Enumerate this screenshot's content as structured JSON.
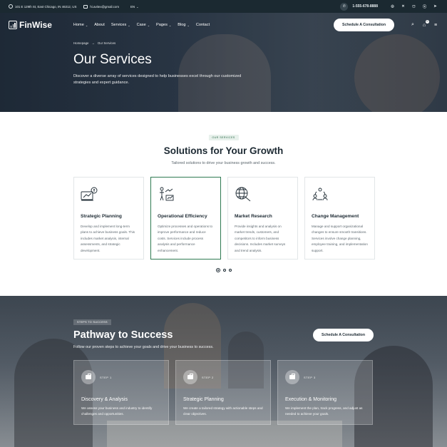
{
  "topbar": {
    "address": "101 E 129th St, East Chicago, IN 46312, US",
    "email": "hi.avitex@gmail.com",
    "language": "EN",
    "phone": "1-555-678-8888",
    "socials": [
      "whatsapp-icon",
      "x-icon",
      "instagram-icon",
      "skype-icon",
      "telegram-icon"
    ]
  },
  "nav": {
    "logo": "FinWise",
    "items": [
      {
        "label": "Home",
        "dropdown": true
      },
      {
        "label": "About",
        "dropdown": false
      },
      {
        "label": "Services",
        "dropdown": true
      },
      {
        "label": "Case",
        "dropdown": true
      },
      {
        "label": "Pages",
        "dropdown": true
      },
      {
        "label": "Blog",
        "dropdown": true
      },
      {
        "label": "Contact",
        "dropdown": false
      }
    ],
    "cta": "Schedule A Consultation"
  },
  "hero": {
    "breadcrumb": [
      "Homepage",
      "Our Services"
    ],
    "title": "Our Services",
    "subtitle": "Discover a diverse array of services designed to help businesses excel through our customized strategies and expert guidance."
  },
  "services": {
    "tag": "OUR SERVICES",
    "title": "Solutions for Your Growth",
    "subtitle": "Tailored solutions to drive your business growth and success.",
    "cards": [
      {
        "title": "Strategic Planning",
        "text": "Develop and implement long-term plans to achieve business goals. This includes market analysis, internal assessments, and strategic development."
      },
      {
        "title": "Operational Efficiency",
        "text": "Optimize processes and operations to improve performance and reduce costs. Services include process analysis and performance enhancement."
      },
      {
        "title": "Market Research",
        "text": "Provide insights and analysis on market trends, customers, and competitors to inform business decisions. Includes market surveys and trend analysis."
      },
      {
        "title": "Change Management",
        "text": "Manage and support organizational changes to ensure smooth transitions. Services involve change planning, employee training, and implementation support."
      }
    ],
    "active_card": 1,
    "pager_active": 0,
    "pager_count": 3
  },
  "pathway": {
    "tag": "STEPS TO SUCCESS",
    "title": "Pathway to Success",
    "subtitle": "Follow our proven steps to achieve your goals and drive your business to success.",
    "cta": "Schedule A Consultation",
    "steps": [
      {
        "num": "STEP 1",
        "title": "Discovery & Analysis",
        "text": "We assess your business and industry to identify challenges and opportunities."
      },
      {
        "num": "STEP 2",
        "title": "Strategic Planning",
        "text": "We create a tailored strategy with actionable steps and clear objectives."
      },
      {
        "num": "STEP 3",
        "title": "Execution & Monitoring",
        "text": "We implement the plan, track progress, and adjust as needed to achieve your goals."
      }
    ]
  },
  "colors": {
    "accent": "#2f7a52",
    "dark": "#1b2931",
    "tag_bg": "#e8f1ec"
  }
}
